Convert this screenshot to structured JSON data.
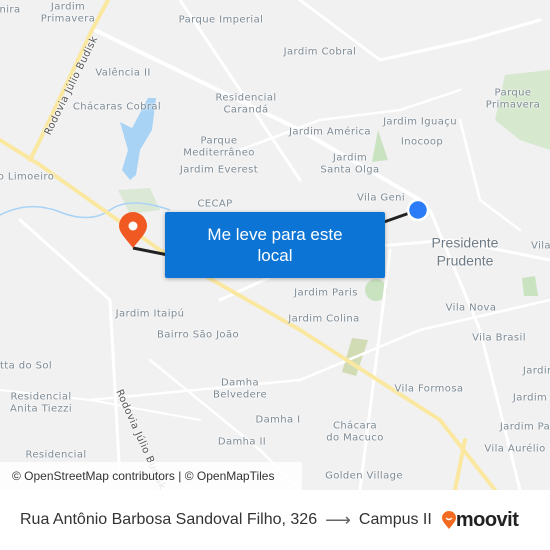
{
  "map": {
    "labels": {
      "jardim_primavera_1": "Jardim",
      "jardim_primavera_2": "Primavera",
      "nira": "nira",
      "parque_imperial": "Parque Imperial",
      "rodovia_1": "Rodovia Júlio Budisk",
      "valencia": "Valência II",
      "carandá_1": "Residencial",
      "carandá_2": "Carandá",
      "jardim_cobral": "Jardim Cobral",
      "chacaras_cobral": "Chácaras Cobral",
      "mediterraneo_1": "Parque",
      "mediterraneo_2": "Mediterrâneo",
      "everest": "Jardim Everest",
      "america": "Jardim América",
      "iguacu": "Jardim Iguaçu",
      "inocoop": "Inocoop",
      "parque_primavera_1": "Parque",
      "parque_primavera_2": "Primavera",
      "santa_olga_1": "Jardim",
      "santa_olga_2": "Santa Olga",
      "vila_geni": "Vila Geni",
      "cecap": "CECAP",
      "limoeiro": "o Limoeiro",
      "presidente": "Presidente",
      "prudente": "Prudente",
      "vila_right": "Vila",
      "jardim_paris": "Jardim Paris",
      "jardim_colina": "Jardim Colina",
      "vila_nova": "Vila Nova",
      "vila_brasil": "Vila Brasil",
      "itaipu": "Jardim Itaipú",
      "sao_joao": "Bairro São João",
      "do_sol": "tta do Sol",
      "anita_1": "Residencial",
      "anita_2": "Anita Tiezzi",
      "rodovia_2": "Rodovia Júlio Budisk",
      "belvedere_1": "Damha",
      "belvedere_2": "Belvedere",
      "damha_1": "Damha I",
      "damha_2": "Damha II",
      "macuco_1": "Chácara",
      "macuco_2": "do Macuco",
      "vila_formosa": "Vila Formosa",
      "jardim_r1": "Jardim",
      "jardim_r2": "Jardim",
      "jardim_pa": "Jardim Pa",
      "vila_aurelio": "Vila Aurélio",
      "golden_village": "Golden Village",
      "residencial_bottom": "Residencial"
    },
    "popup_label": "Me leve para este local",
    "attribution": "© OpenStreetMap contributors | © OpenMapTiles",
    "origin_marker_color": "#2b7cf6",
    "destination_marker_color": "#f05a22",
    "popup_color": "#0c74d4"
  },
  "footer": {
    "from": "Rua Antônio Barbosa Sandoval Filho, 326",
    "arrow": "⟶",
    "to": "Campus II",
    "brand": "moovit",
    "brand_color": "#f26b21"
  }
}
